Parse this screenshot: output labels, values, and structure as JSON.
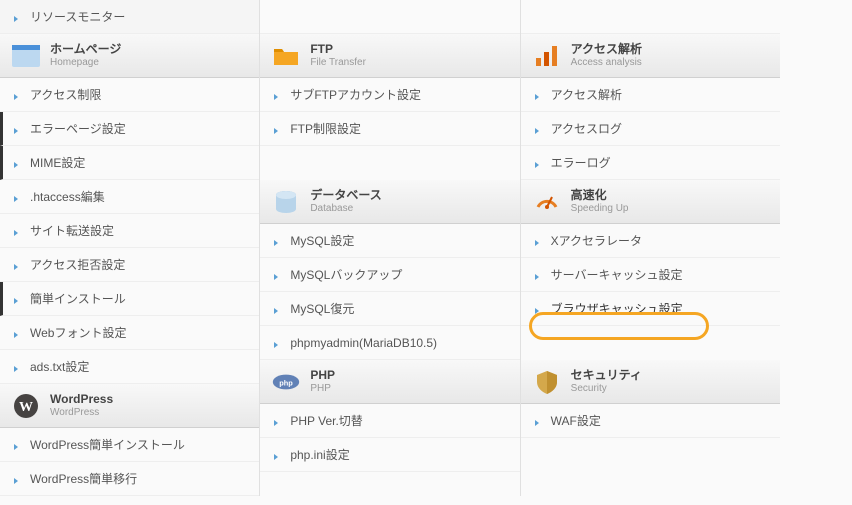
{
  "columns": [
    {
      "presections": [
        {
          "items": [
            {
              "label": "リソースモニター"
            }
          ]
        }
      ],
      "sections": [
        {
          "header": {
            "title": "ホームページ",
            "subtitle": "Homepage",
            "icon": "homepage-icon"
          },
          "items": [
            {
              "label": "アクセス制限"
            },
            {
              "label": "エラーページ設定",
              "active": true
            },
            {
              "label": "MIME設定",
              "active": true
            },
            {
              "label": ".htaccess編集"
            },
            {
              "label": "サイト転送設定"
            },
            {
              "label": "アクセス拒否設定"
            },
            {
              "label": "簡単インストール",
              "active": true
            },
            {
              "label": "Webフォント設定"
            },
            {
              "label": "ads.txt設定"
            }
          ]
        },
        {
          "header": {
            "title": "WordPress",
            "subtitle": "WordPress",
            "icon": "wordpress-icon"
          },
          "items": [
            {
              "label": "WordPress簡単インストール"
            },
            {
              "label": "WordPress簡単移行"
            }
          ]
        }
      ]
    },
    {
      "presections": [],
      "sections": [
        {
          "header": {
            "title": "FTP",
            "subtitle": "File Transfer",
            "icon": "ftp-icon"
          },
          "items": [
            {
              "label": "サブFTPアカウント設定"
            },
            {
              "label": "FTP制限設定"
            }
          ]
        },
        {
          "header": {
            "title": "データベース",
            "subtitle": "Database",
            "icon": "database-icon"
          },
          "items": [
            {
              "label": "MySQL設定"
            },
            {
              "label": "MySQLバックアップ"
            },
            {
              "label": "MySQL復元"
            },
            {
              "label": "phpmyadmin(MariaDB10.5)"
            }
          ]
        },
        {
          "header": {
            "title": "PHP",
            "subtitle": "PHP",
            "icon": "php-icon"
          },
          "items": [
            {
              "label": "PHP Ver.切替"
            },
            {
              "label": "php.ini設定"
            }
          ]
        }
      ]
    },
    {
      "presections": [],
      "sections": [
        {
          "header": {
            "title": "アクセス解析",
            "subtitle": "Access analysis",
            "icon": "analysis-icon"
          },
          "items": [
            {
              "label": "アクセス解析"
            },
            {
              "label": "アクセスログ"
            },
            {
              "label": "エラーログ"
            }
          ]
        },
        {
          "header": {
            "title": "高速化",
            "subtitle": "Speeding Up",
            "icon": "speedup-icon"
          },
          "items": [
            {
              "label": "Xアクセラレータ"
            },
            {
              "label": "サーバーキャッシュ設定"
            },
            {
              "label": "ブラウザキャッシュ設定",
              "highlighted": true
            }
          ]
        },
        {
          "header": {
            "title": "セキュリティ",
            "subtitle": "Security",
            "icon": "security-icon"
          },
          "items": [
            {
              "label": "WAF設定"
            }
          ]
        }
      ]
    }
  ]
}
